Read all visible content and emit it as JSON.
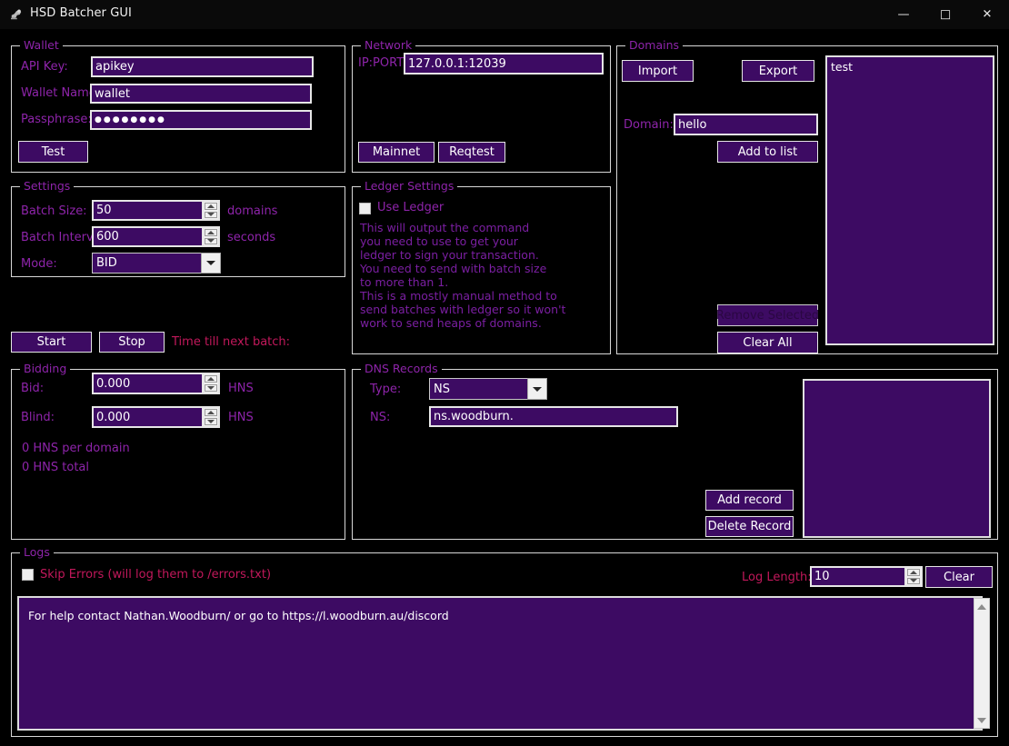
{
  "window": {
    "title": "HSD Batcher GUI",
    "icon": "app-icon",
    "minimize": "—",
    "maximize": "□",
    "close": "✕"
  },
  "wallet": {
    "legend": "Wallet",
    "api_key_label": "API Key:",
    "api_key_value": "apikey",
    "wallet_name_label": "Wallet Name:",
    "wallet_name_value": "wallet",
    "passphrase_label": "Passphrase:",
    "passphrase_value": "●●●●●●●●",
    "test_button": "Test"
  },
  "network": {
    "legend": "Network",
    "ipport_label": "IP:PORT",
    "ipport_value": "127.0.0.1:12039",
    "mainnet_button": "Mainnet",
    "regtest_button": "Reqtest"
  },
  "domains": {
    "legend": "Domains",
    "import_button": "Import",
    "export_button": "Export",
    "domain_label": "Domain:",
    "domain_value": "hello",
    "add_to_list_button": "Add to list",
    "remove_selected_button": "Remove Selected",
    "remove_selected_disabled": true,
    "clear_all_button": "Clear All",
    "list_items": [
      "test"
    ]
  },
  "settings": {
    "legend": "Settings",
    "batch_size_label": "Batch Size:",
    "batch_size_value": "50",
    "batch_size_unit": "domains",
    "batch_interval_label": "Batch Interval:",
    "batch_interval_value": "600",
    "batch_interval_unit": "seconds",
    "mode_label": "Mode:",
    "mode_value": "BID",
    "mode_options": [
      "BID"
    ]
  },
  "run": {
    "start_button": "Start",
    "stop_button": "Stop",
    "timer_label": "Time till next batch:"
  },
  "ledger": {
    "legend": "Ledger Settings",
    "use_ledger_label": "Use Ledger",
    "use_ledger_checked": false,
    "description": "This will output the command\nyou need to use to get your\nledger to sign your transaction.\nYou need to send with batch size\nto more than 1.\nThis is a mostly manual method to\nsend batches with ledger so it won't\nwork to send heaps of domains."
  },
  "bidding": {
    "legend": "Bidding",
    "bid_label": "Bid:",
    "bid_value": "0.000",
    "bid_unit": "HNS",
    "blind_label": "Blind:",
    "blind_value": "0.000",
    "blind_unit": "HNS",
    "per_domain_text": "0 HNS per domain",
    "total_text": "0 HNS total"
  },
  "dns": {
    "legend": "DNS Records",
    "type_label": "Type:",
    "type_value": "NS",
    "type_options": [
      "NS"
    ],
    "ns_label": "NS:",
    "ns_value": "ns.woodburn.",
    "add_record_button": "Add record",
    "delete_record_button": "Delete Record",
    "records": []
  },
  "logs": {
    "legend": "Logs",
    "skip_errors_label": "Skip Errors (will log them to /errors.txt)",
    "skip_errors_checked": false,
    "log_length_label": "Log Length:",
    "log_length_value": "10",
    "clear_button": "Clear",
    "lines": [
      "For help contact Nathan.Woodburn/ or go to https://l.woodburn.au/discord"
    ]
  },
  "colors": {
    "background": "#000000",
    "label_purple": "#8E24AA",
    "label_pink": "#C2185B",
    "field_fill": "#3D0B63",
    "border_light": "#E6E6E6",
    "text_white": "#FFFFFF"
  }
}
